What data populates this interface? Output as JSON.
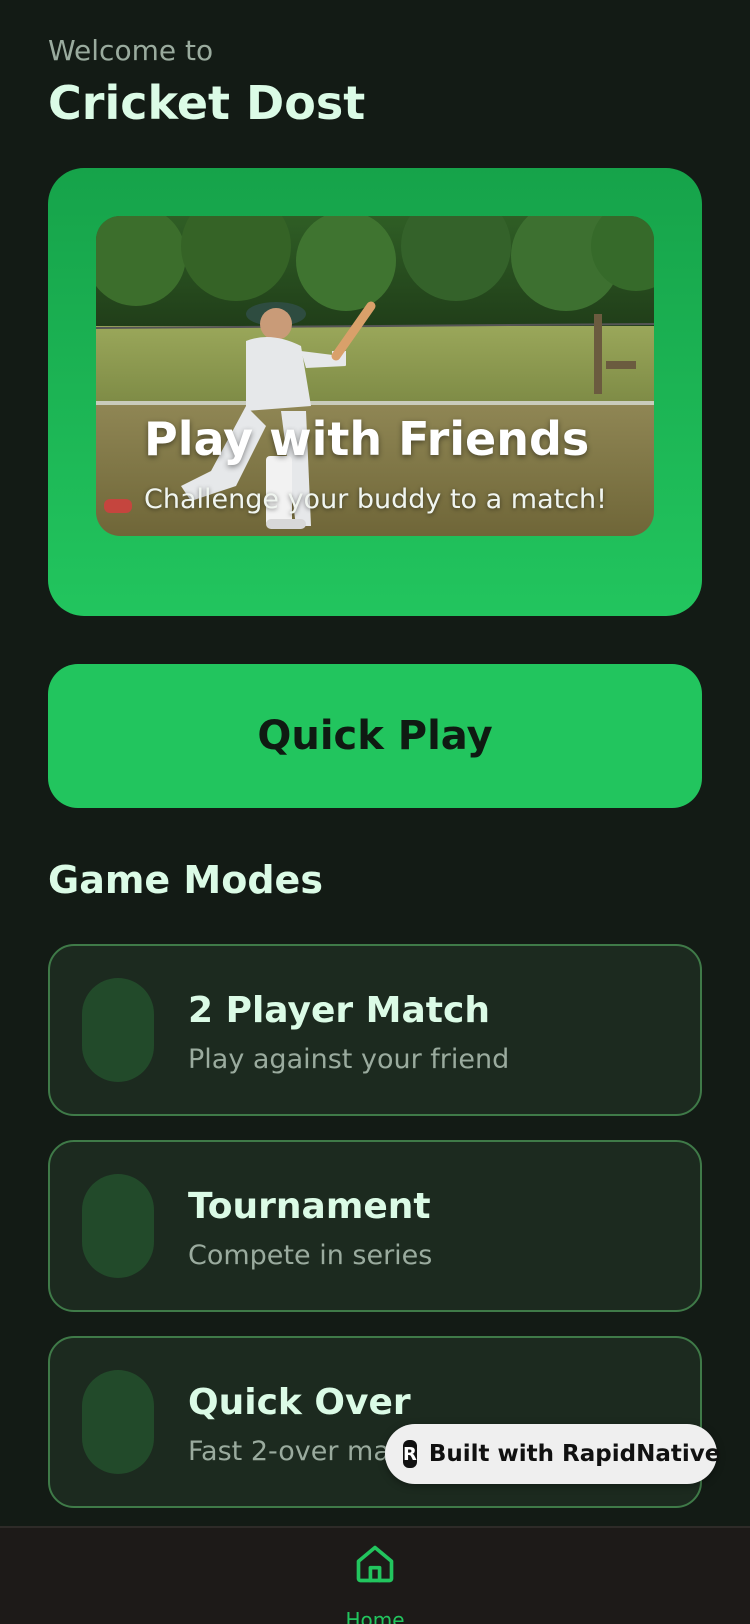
{
  "header": {
    "welcome": "Welcome to",
    "app_name": "Cricket Dost"
  },
  "hero": {
    "title": "Play with Friends",
    "subtitle": "Challenge your buddy to a match!"
  },
  "quick_play": {
    "label": "Quick Play"
  },
  "game_modes": {
    "title": "Game Modes",
    "items": [
      {
        "title": "2 Player Match",
        "description": "Play against your friend"
      },
      {
        "title": "Tournament",
        "description": "Compete in series"
      },
      {
        "title": "Quick Over",
        "description": "Fast 2-over match"
      }
    ]
  },
  "badge": {
    "label": "Built with RapidNative"
  },
  "tab_bar": {
    "home_label": "Home"
  },
  "colors": {
    "accent": "#22c55e",
    "background": "#131b15",
    "card": "#1c2a1f",
    "card_border": "#3f7a48",
    "title_text": "#dbfbe6"
  }
}
